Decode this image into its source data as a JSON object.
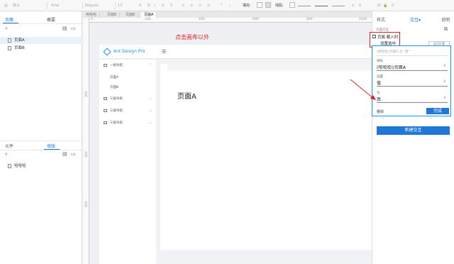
{
  "toolbar": {
    "default_label": "默认",
    "font_name": "Arial",
    "font_weight": "Regular",
    "font_size": "13",
    "fill_label": "填充:",
    "stroke_label": "线段:",
    "x_label": "x",
    "x_value": "0",
    "w_label": "W",
    "w_value": "0"
  },
  "left_panel": {
    "tabs": [
      "页面",
      "概要"
    ],
    "pages": [
      {
        "label": "页面A",
        "selected": true
      },
      {
        "label": "页面B",
        "selected": false
      }
    ],
    "lower_tabs": [
      "元件",
      "母版"
    ],
    "masters": [
      {
        "label": "哈哈哈"
      }
    ]
  },
  "file_tabs": [
    "哈哈哈",
    "页面B",
    "页面B",
    "页面A"
  ],
  "ruler": {
    "top": [
      "0",
      "200",
      "400",
      "600",
      "800",
      "1000"
    ],
    "left": [
      "200",
      "400",
      "600"
    ]
  },
  "canvas": {
    "annotation": "点击画布以外",
    "app": {
      "logo_text": "Ant Design Pro",
      "menu": [
        {
          "label": "一级导航",
          "expanded": true
        },
        {
          "label": "页面A"
        },
        {
          "label": "页面B"
        },
        {
          "label": "三级导航"
        },
        {
          "label": "三级导航"
        },
        {
          "label": "三级导航"
        }
      ],
      "page_title": "页面A"
    }
  },
  "right_panel": {
    "tabs": [
      "样式",
      "交互",
      "说明"
    ],
    "interact_caret": "▾",
    "section_label": "页面交互",
    "event": {
      "line1": "页面 载入时",
      "line2": "设置选中"
    },
    "expand_label": "展开折叠",
    "summary": "(哈哈哈)/页面A 为 \"真\"",
    "target_label": "目标",
    "target_value": "(哈哈哈)/页面A",
    "set_label": "设置",
    "set_value": "值",
    "to_label": "为",
    "to_value": "真",
    "delete_label": "删除",
    "done_label": "完成",
    "new_interaction_label": "新建交互"
  },
  "colors": {
    "accent": "#1f77d6",
    "annotation_red": "#e02020",
    "brand_blue": "#1890ff"
  }
}
